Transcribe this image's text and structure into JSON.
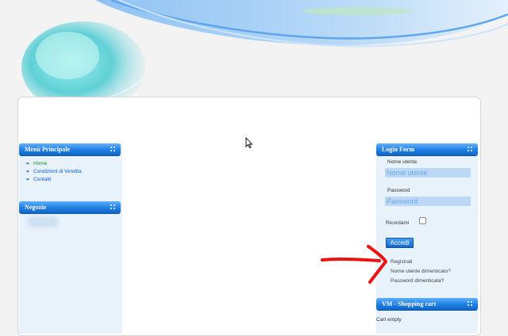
{
  "left_sidebar": {
    "main_menu": {
      "title": "Menù Principale",
      "items": [
        "Home",
        "Condizioni di Vendita",
        "Contatti"
      ]
    },
    "shop": {
      "title": "Negozio"
    }
  },
  "login_form": {
    "title": "Login Form",
    "username_label": "Nome utente",
    "username_placeholder": "Nome utente",
    "password_label": "Password",
    "password_placeholder": "Password",
    "remember_label": "Ricordami",
    "login_button": "Accedi",
    "register_link": "Registrati",
    "forgot_username_link": "Nome utente dimenticato?",
    "forgot_password_link": "Password dimenticata?"
  },
  "cart": {
    "title": "VM - Shopping cart",
    "status": "Cart empty"
  },
  "colors": {
    "module_header": "#1f7fe0",
    "sidebar_bg": "#e8f2fb",
    "active_link": "#1c8a1c",
    "link": "#0a5ed0",
    "annotation": "#ee1111"
  }
}
